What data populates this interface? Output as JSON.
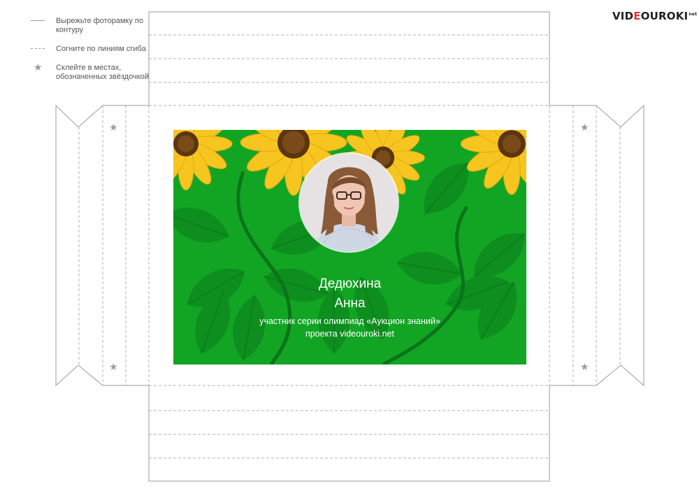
{
  "legend": {
    "cut": "Вырежьте фоторамку по контуру",
    "fold": "Согните по линиям сгиба",
    "glue": "Склейте в местах, обозначенных звёздочкой"
  },
  "logo": {
    "pre": "VID",
    "accent": "E",
    "post": "OUROKI",
    "suffix": "net"
  },
  "card": {
    "name_first": "Дедюхина",
    "name_second": "Анна",
    "caption_line1": "участник серии олимпиад «Аукцион знаний»",
    "caption_line2": "проекта videouroki.net"
  },
  "colors": {
    "background_green": "#12a524",
    "leaf_green": "#0d8a1e",
    "petal_yellow": "#f7c520",
    "seed_brown": "#5a3510",
    "line_gray": "#9a9a9a"
  },
  "icons": [
    "star-icon"
  ]
}
